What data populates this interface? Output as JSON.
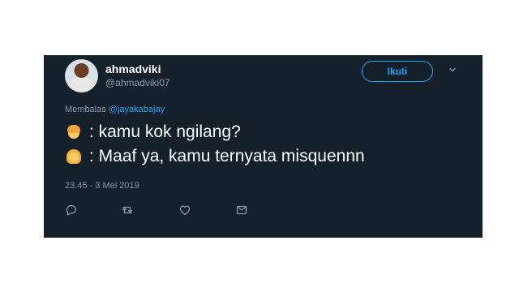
{
  "user": {
    "display_name": "ahmadviki",
    "handle": "@ahmadviki07"
  },
  "follow_button": {
    "label": "Ikuti"
  },
  "reply": {
    "prefix": "Membalas",
    "target": "@jayakabajay"
  },
  "tweet": {
    "line1": ": kamu kok ngilang?",
    "line2": ": Maaf ya, kamu ternyata misquennn",
    "timestamp": "23.45 - 3 Mei 2019"
  },
  "icons": {
    "line1_emoji": "man-emoji",
    "line2_emoji": "woman-emoji",
    "more": "chevron-down-icon",
    "reply": "reply-icon",
    "retweet": "retweet-icon",
    "like": "heart-icon",
    "dm": "mail-icon"
  },
  "colors": {
    "card_background": "#15202b",
    "text": "#ffffff",
    "muted": "#8899a6",
    "accent": "#1da1f2"
  }
}
